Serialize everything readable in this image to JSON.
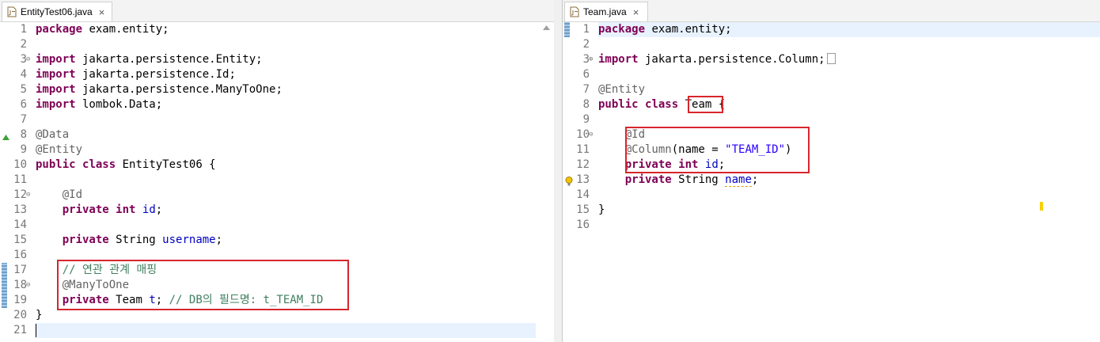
{
  "left": {
    "tab_title": "EntityTest06.java",
    "tab_close": "×",
    "lines": [
      {
        "n": "1"
      },
      {
        "n": "2"
      },
      {
        "n": "3"
      },
      {
        "n": "4"
      },
      {
        "n": "5"
      },
      {
        "n": "6"
      },
      {
        "n": "7"
      },
      {
        "n": "8"
      },
      {
        "n": "9"
      },
      {
        "n": "10"
      },
      {
        "n": "11"
      },
      {
        "n": "12"
      },
      {
        "n": "13"
      },
      {
        "n": "14"
      },
      {
        "n": "15"
      },
      {
        "n": "16"
      },
      {
        "n": "17"
      },
      {
        "n": "18"
      },
      {
        "n": "19"
      },
      {
        "n": "20"
      },
      {
        "n": "21"
      }
    ],
    "code": {
      "l1a": "package",
      "l1b": " exam.entity;",
      "l3a": "import",
      "l3b": " jakarta.persistence.Entity;",
      "l4a": "import",
      "l4b": " jakarta.persistence.Id;",
      "l5a": "import",
      "l5b": " jakarta.persistence.ManyToOne;",
      "l6a": "import",
      "l6b": " lombok.Data;",
      "l8": "@Data",
      "l9": "@Entity",
      "l10a": "public",
      "l10b": "class",
      "l10c": " EntityTest06 {",
      "l12": "    @Id",
      "l13a": "private",
      "l13b": "int",
      "l13c": "id",
      "l13d": ";",
      "l15a": "private",
      "l15b": " String ",
      "l15c": "username",
      "l15d": ";",
      "l17": "    // 연관 관계 매핑",
      "l18": "    @ManyToOne",
      "l19a": "private",
      "l19b": " Team ",
      "l19c": "t",
      "l19d": "; ",
      "l19e": "// DB의 필드명: t_TEAM_ID",
      "l20": "}"
    }
  },
  "right": {
    "tab_title": "Team.java",
    "tab_close": "×",
    "lines": [
      {
        "n": "1"
      },
      {
        "n": "2"
      },
      {
        "n": "3"
      },
      {
        "n": "6"
      },
      {
        "n": "7"
      },
      {
        "n": "8"
      },
      {
        "n": "9"
      },
      {
        "n": "10"
      },
      {
        "n": "11"
      },
      {
        "n": "12"
      },
      {
        "n": "13"
      },
      {
        "n": "14"
      },
      {
        "n": "15"
      },
      {
        "n": "16"
      }
    ],
    "code": {
      "r1a": "package",
      "r1b": " exam.entity;",
      "r3a": "import",
      "r3b": " jakarta.persistence.Column;",
      "r7": "@Entity",
      "r8a": "public",
      "r8b": "class",
      "r8c": "Team",
      "r8d": " {",
      "r10": "    @Id",
      "r11a": "    @Column",
      "r11b": "(name = ",
      "r11c": "\"TEAM_ID\"",
      "r11d": ")",
      "r12a": "private",
      "r12b": "int",
      "r12c": "id",
      "r12d": ";",
      "r13a": "private",
      "r13b": " String ",
      "r13c": "name",
      "r13d": ";",
      "r15": "}"
    }
  },
  "icons": {
    "file": "java-file-icon",
    "fold_collapse": "⊖",
    "fold_expand": "⊕",
    "override": "override-triangle-icon",
    "warning": "warning-bulb-icon"
  },
  "colors": {
    "keyword": "#7f0055",
    "annotation": "#646464",
    "field": "#0000c0",
    "comment": "#3f7f5f",
    "string": "#2a00ff",
    "highlight_box": "#d7262c"
  }
}
